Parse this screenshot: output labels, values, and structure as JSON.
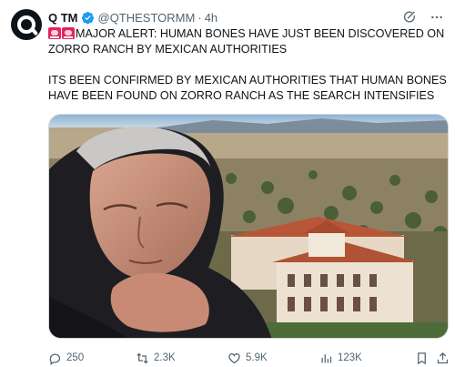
{
  "tweet": {
    "display_name": "Q TM",
    "handle": "@QTHESTORMM",
    "separator": "·",
    "time": "4h",
    "line1": "MAJOR ALERT: HUMAN BONES HAVE JUST BEEN DISCOVERED ON",
    "line2": "ZORRO RANCH BY MEXICAN AUTHORITIES",
    "line3": "ITS BEEN CONFIRMED BY MEXICAN AUTHORITIES THAT HUMAN BONES",
    "line4": "HAVE BEEN FOUND ON ZORRO RANCH AS THE SEARCH INTENSIFIES"
  },
  "metrics": {
    "replies": "250",
    "reposts": "2.3K",
    "likes": "5.9K",
    "views": "123K"
  },
  "colors": {
    "text": "#0f1419",
    "secondary": "#536471",
    "verified": "#1d9bf0",
    "siren": "#e0245e",
    "border": "#cfd9de"
  },
  "icons": {
    "verified": "verified-badge-icon",
    "grok": "grok-icon",
    "more": "more-icon",
    "siren": "rotating-light-emoji",
    "reply": "reply-icon",
    "repost": "repost-icon",
    "like": "heart-icon",
    "views": "views-icon",
    "bookmark": "bookmark-icon",
    "share": "share-icon"
  }
}
